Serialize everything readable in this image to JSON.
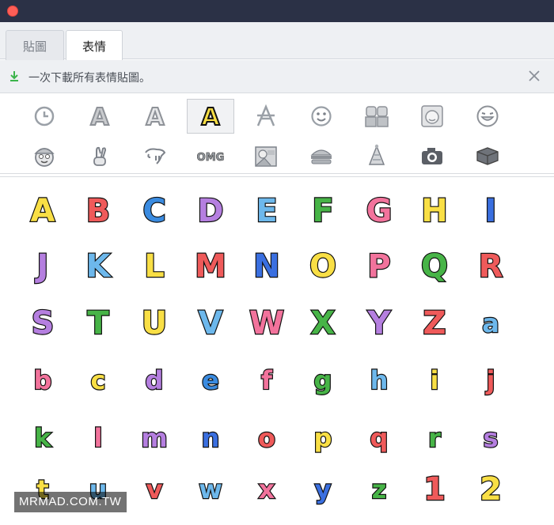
{
  "window": {
    "close_color": "#fe5f57"
  },
  "tabs": [
    {
      "label": "貼圖",
      "active": false
    },
    {
      "label": "表情",
      "active": true
    }
  ],
  "notice": {
    "text": "一次下載所有表情貼圖。",
    "icon": "download-icon",
    "icon_color": "#3cb44b",
    "close_icon": "close-icon"
  },
  "tray": {
    "row1": [
      "clock-icon",
      "letter-a-gray-icon",
      "letter-a-outline-icon",
      "letter-a-yellow-icon",
      "letter-a-strike-icon",
      "smiley-icon",
      "couple-icon",
      "face-icon",
      "grin-face-icon"
    ],
    "row2": [
      "cap-face-icon",
      "crossed-fingers-icon",
      "dog-icon",
      "omg-icon",
      "cards-icon",
      "burger-icon",
      "party-hat-icon",
      "camera-icon",
      "box-icon"
    ],
    "selected_index": 3,
    "selected_letter": "A",
    "gray_letter": "A",
    "omg_text": "OMG"
  },
  "emoji_grid": [
    [
      {
        "ch": "A",
        "color": "#f9df45"
      },
      {
        "ch": "B",
        "color": "#ef5a5a"
      },
      {
        "ch": "C",
        "color": "#3a8be0"
      },
      {
        "ch": "D",
        "color": "#b57fe0"
      },
      {
        "ch": "E",
        "color": "#6db8ec"
      },
      {
        "ch": "F",
        "color": "#47b447"
      },
      {
        "ch": "G",
        "color": "#f2739c"
      },
      {
        "ch": "H",
        "color": "#f9df45"
      },
      {
        "ch": "I",
        "color": "#3a6fe0"
      }
    ],
    [
      {
        "ch": "J",
        "color": "#b57fe0"
      },
      {
        "ch": "K",
        "color": "#6db8ec"
      },
      {
        "ch": "L",
        "color": "#f9df45"
      },
      {
        "ch": "M",
        "color": "#ef5a5a"
      },
      {
        "ch": "N",
        "color": "#3a6fe0"
      },
      {
        "ch": "O",
        "color": "#f9df45"
      },
      {
        "ch": "P",
        "color": "#f2739c"
      },
      {
        "ch": "Q",
        "color": "#47b447"
      },
      {
        "ch": "R",
        "color": "#ef5a5a"
      }
    ],
    [
      {
        "ch": "S",
        "color": "#b57fe0"
      },
      {
        "ch": "T",
        "color": "#47b447"
      },
      {
        "ch": "U",
        "color": "#f9df45"
      },
      {
        "ch": "V",
        "color": "#6db8ec"
      },
      {
        "ch": "W",
        "color": "#f2739c"
      },
      {
        "ch": "X",
        "color": "#47b447"
      },
      {
        "ch": "Y",
        "color": "#b57fe0"
      },
      {
        "ch": "Z",
        "color": "#ef5a5a"
      },
      {
        "ch": "a",
        "color": "#6db8ec"
      }
    ],
    [
      {
        "ch": "b",
        "color": "#f2739c"
      },
      {
        "ch": "c",
        "color": "#f9df45"
      },
      {
        "ch": "d",
        "color": "#b57fe0"
      },
      {
        "ch": "e",
        "color": "#3a8be0"
      },
      {
        "ch": "f",
        "color": "#f2739c"
      },
      {
        "ch": "g",
        "color": "#47b447"
      },
      {
        "ch": "h",
        "color": "#6db8ec"
      },
      {
        "ch": "i",
        "color": "#f9df45"
      },
      {
        "ch": "j",
        "color": "#ef5a5a"
      }
    ],
    [
      {
        "ch": "k",
        "color": "#47b447"
      },
      {
        "ch": "l",
        "color": "#f2739c"
      },
      {
        "ch": "m",
        "color": "#b57fe0"
      },
      {
        "ch": "n",
        "color": "#3a6fe0"
      },
      {
        "ch": "o",
        "color": "#ef5a5a"
      },
      {
        "ch": "p",
        "color": "#f9df45"
      },
      {
        "ch": "q",
        "color": "#ef5a5a"
      },
      {
        "ch": "r",
        "color": "#47b447"
      },
      {
        "ch": "s",
        "color": "#b57fe0"
      }
    ],
    [
      {
        "ch": "t",
        "color": "#f9df45"
      },
      {
        "ch": "u",
        "color": "#6db8ec"
      },
      {
        "ch": "v",
        "color": "#ef5a5a"
      },
      {
        "ch": "w",
        "color": "#6db8ec"
      },
      {
        "ch": "x",
        "color": "#f2739c"
      },
      {
        "ch": "y",
        "color": "#3a6fe0"
      },
      {
        "ch": "z",
        "color": "#47b447"
      },
      {
        "ch": "1",
        "color": "#ef5a5a"
      },
      {
        "ch": "2",
        "color": "#f9df45"
      }
    ]
  ],
  "watermark": "MRMAD.COM.TW"
}
